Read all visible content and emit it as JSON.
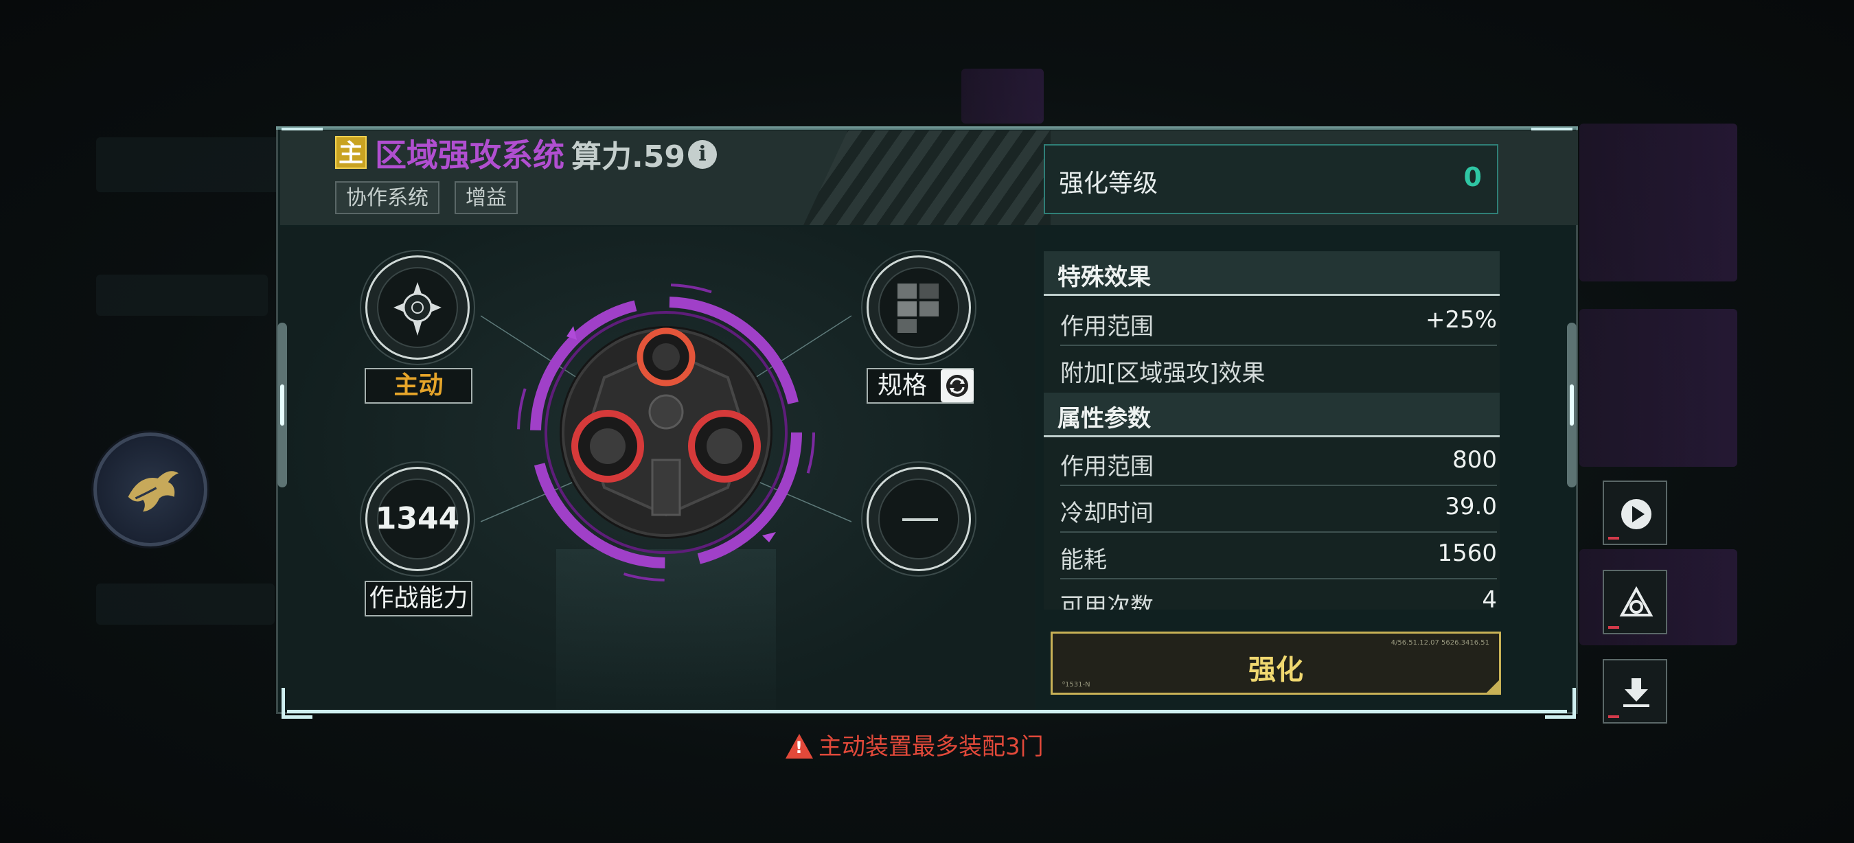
{
  "header": {
    "badge": "主",
    "title": "区域强攻系统",
    "power": "算力.59",
    "info_icon": "i",
    "tags": [
      "协作系统",
      "增益"
    ]
  },
  "enhance_level": {
    "label": "强化等级",
    "value": "0"
  },
  "slots": {
    "top_left_label": "主动",
    "combat_value": "1344",
    "combat_label": "作战能力",
    "spec_label": "规格"
  },
  "special_effects": {
    "title": "特殊效果",
    "rows": [
      {
        "key": "作用范围",
        "value": "+25%"
      },
      {
        "key": "附加[区域强攻]效果",
        "value": ""
      }
    ]
  },
  "attributes": {
    "title": "属性参数",
    "rows": [
      {
        "key": "作用范围",
        "value": "800"
      },
      {
        "key": "冷却时间",
        "value": "39.0"
      },
      {
        "key": "能耗",
        "value": "1560"
      },
      {
        "key": "可用次数",
        "value": "4"
      }
    ]
  },
  "enhance_button": {
    "label": "强化",
    "tiny_left": "⁰1531-N",
    "tiny_right": "4/56.51.12.07    5626.3416.51"
  },
  "warning": "主动装置最多装配3门",
  "colors": {
    "title": "#b14fd0",
    "accent_green": "#2fc6a4",
    "gold": "#f0d870",
    "warning": "#e2493a",
    "active": "#e6a52a"
  },
  "side_buttons": [
    "play-icon",
    "triangle-logo-icon",
    "download-icon"
  ]
}
